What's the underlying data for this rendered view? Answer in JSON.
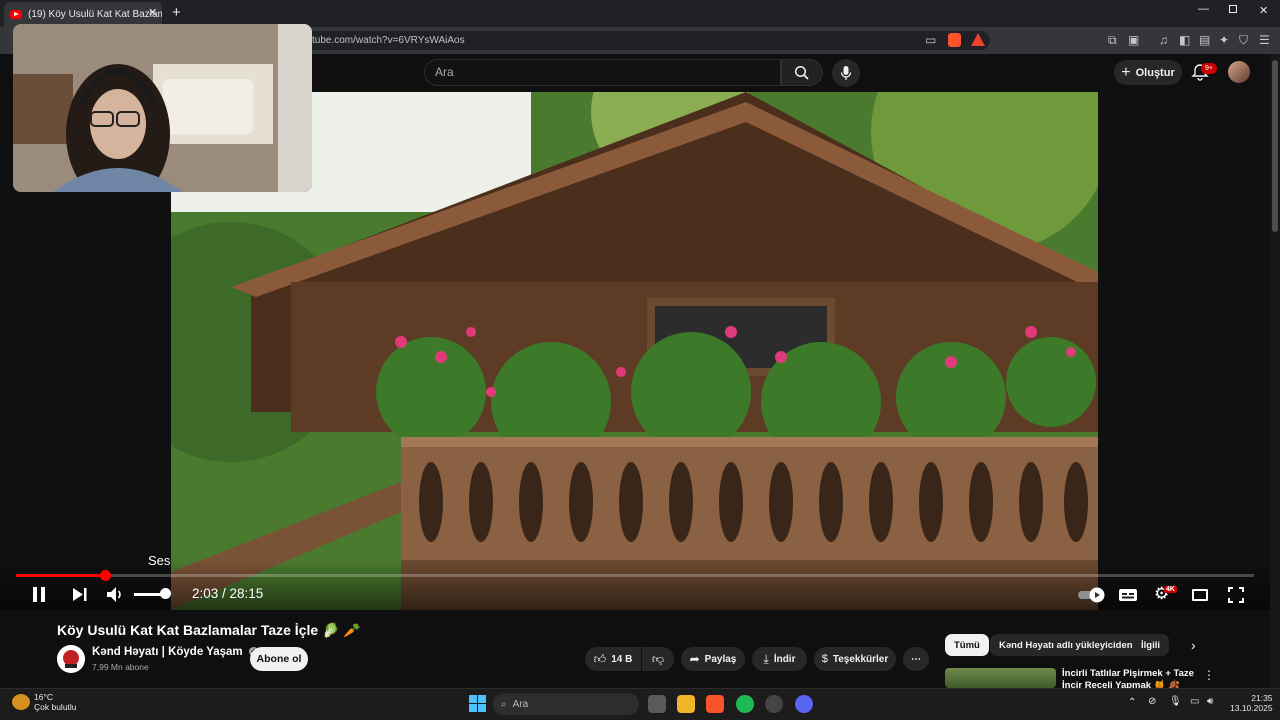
{
  "browser": {
    "tab_title": "(19) Köy Usulü Kat Kat Bazlam",
    "url": "tube.com/watch?v=6VRYsWAiAos"
  },
  "header": {
    "search_placeholder": "Ara",
    "create_label": "Oluştur",
    "notifications_badge": "9+"
  },
  "player": {
    "tooltip": "Ses",
    "current_time": "2:03",
    "duration": "28:15",
    "time_display": "2:03 / 28:15",
    "progress_fraction": 0.072,
    "volume_fraction": 0.75,
    "quality_badge": "4K"
  },
  "video": {
    "title": "Köy Usulü Kat Kat Bazlamalar Taze İçle 🥬 🥕",
    "channel_name": "Kənd Həyatı | Köyde Yaşam",
    "subscribers": "7,99 Mn abone",
    "subscribe_label": "Abone ol",
    "likes": "14 B",
    "share_label": "Paylaş",
    "download_label": "İndir",
    "thanks_label": "Teşekkürler",
    "more_label": "⋯"
  },
  "recommendations": {
    "chips": [
      "Tümü",
      "Kənd Həyatı adlı yükleyiciden",
      "İlgili"
    ],
    "first_title": "İncirli Tatlılar Pişirmek + Taze İncir Reçeli Yapmak 🍯 🍂"
  },
  "taskbar": {
    "weather_temp": "16°C",
    "weather_desc": "Çok bulutlu",
    "search_label": "Ara",
    "time": "21:35",
    "date": "13.10.2025"
  },
  "colors": {
    "accent": "#ff0000",
    "background": "#0f0f0f",
    "chip_bg": "#272727"
  }
}
